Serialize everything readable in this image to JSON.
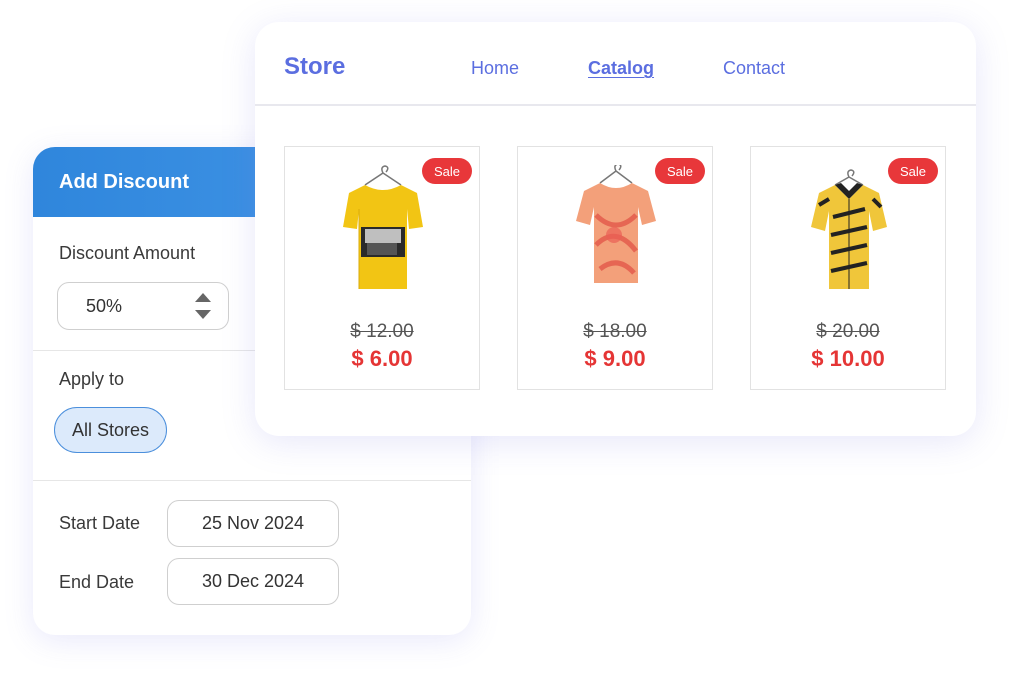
{
  "discount_panel": {
    "title": "Add Discount",
    "amount_label": "Discount Amount",
    "amount_value": "50%",
    "apply_label": "Apply to",
    "apply_chip": "All Stores",
    "start_label": "Start Date",
    "start_value": "25 Nov 2024",
    "end_label": "End Date",
    "end_value": "30 Dec 2024"
  },
  "store": {
    "brand": "Store",
    "nav": [
      {
        "label": "Home",
        "active": false
      },
      {
        "label": "Catalog",
        "active": true
      },
      {
        "label": "Contact",
        "active": false
      }
    ],
    "products": [
      {
        "badge": "Sale",
        "old_price": "$ 12.00",
        "new_price": "$ 6.00",
        "image": "yellow-tshirt-icon"
      },
      {
        "badge": "Sale",
        "old_price": "$ 18.00",
        "new_price": "$ 9.00",
        "image": "tiedye-tshirt-icon"
      },
      {
        "badge": "Sale",
        "old_price": "$ 20.00",
        "new_price": "$ 10.00",
        "image": "patterned-shirt-icon"
      }
    ]
  },
  "colors": {
    "accent_blue": "#2f86dc",
    "brand_purple": "#5b6ee0",
    "sale_red": "#e53535"
  }
}
